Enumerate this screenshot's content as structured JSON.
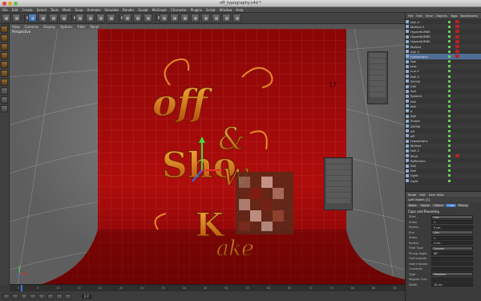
{
  "window": {
    "title": "off_typography.c4d *"
  },
  "menu": [
    "File",
    "Edit",
    "Create",
    "Select",
    "Tools",
    "Mesh",
    "Snap",
    "Animate",
    "Simulate",
    "Render",
    "Sculpt",
    "MoGraph",
    "Character",
    "Plugins",
    "Script",
    "Window",
    "Help"
  ],
  "viewport": {
    "menu": [
      "View",
      "Cameras",
      "Display",
      "Options",
      "Filter",
      "Panel"
    ],
    "label": "Perspective",
    "art": {
      "line1": "off",
      "ampersand": "&",
      "line2": "Sho",
      "line3": "w",
      "line4": "K",
      "line5": "ake",
      "floor_mark": "17"
    }
  },
  "timeline": {
    "ticks": [
      "0",
      "5",
      "10",
      "15",
      "20",
      "25",
      "30",
      "35",
      "40",
      "45",
      "50",
      "55",
      "60",
      "65",
      "70",
      "75",
      "80",
      "85",
      "90"
    ],
    "frame": "0 F"
  },
  "object_manager": {
    "menu": [
      "File",
      "Edit",
      "View",
      "Objects",
      "Tags",
      "Bookmarks"
    ],
    "objects": [
      "Null.4",
      "MoText.3",
      "HyperNURBS",
      "HyperNURBS",
      "HyperNURBS",
      "MoText",
      "Null.3",
      "typography",
      "Null",
      "text",
      "null.3",
      "Null.2",
      "SHOW",
      "Cell",
      "Null",
      "Splotch",
      "Null",
      "Null",
      "K",
      "Null",
      "Shape",
      "SHOW",
      "off",
      "off",
      "typography",
      "MoText",
      "Null.2",
      "Skull",
      "Reflection",
      "Null",
      "Null",
      "Light",
      "Light"
    ]
  },
  "attributes": {
    "menu": [
      "Mode",
      "Edit",
      "User Data"
    ],
    "object": "Loft Object [1]",
    "tabs": [
      "Basic",
      "Coord.",
      "Object",
      "Caps",
      "Phong"
    ],
    "active_tab": "Caps",
    "section": "Caps and Rounding",
    "props": [
      {
        "label": "Start",
        "value": "Cap"
      },
      {
        "label": "Steps",
        "value": "1"
      },
      {
        "label": "Radius",
        "value": "5 cm"
      },
      {
        "label": "End",
        "value": "Cap"
      },
      {
        "label": "Steps",
        "value": "1"
      },
      {
        "label": "Radius",
        "value": "5 cm"
      },
      {
        "label": "Fillet Type",
        "value": "Convex"
      },
      {
        "label": "Phong Angle",
        "value": "60°"
      },
      {
        "label": "Hull Inwards",
        "value": ""
      },
      {
        "label": "Hole Inwards",
        "value": ""
      },
      {
        "label": "Constrain",
        "value": ""
      },
      {
        "label": "Type",
        "value": "Triangles"
      },
      {
        "label": "Regular Grid",
        "value": ""
      },
      {
        "label": "Width",
        "value": "10 cm"
      }
    ]
  },
  "colors": {
    "backdrop": "#a50a0a",
    "letters": "#d86a10",
    "accent": "#3c72c4"
  }
}
